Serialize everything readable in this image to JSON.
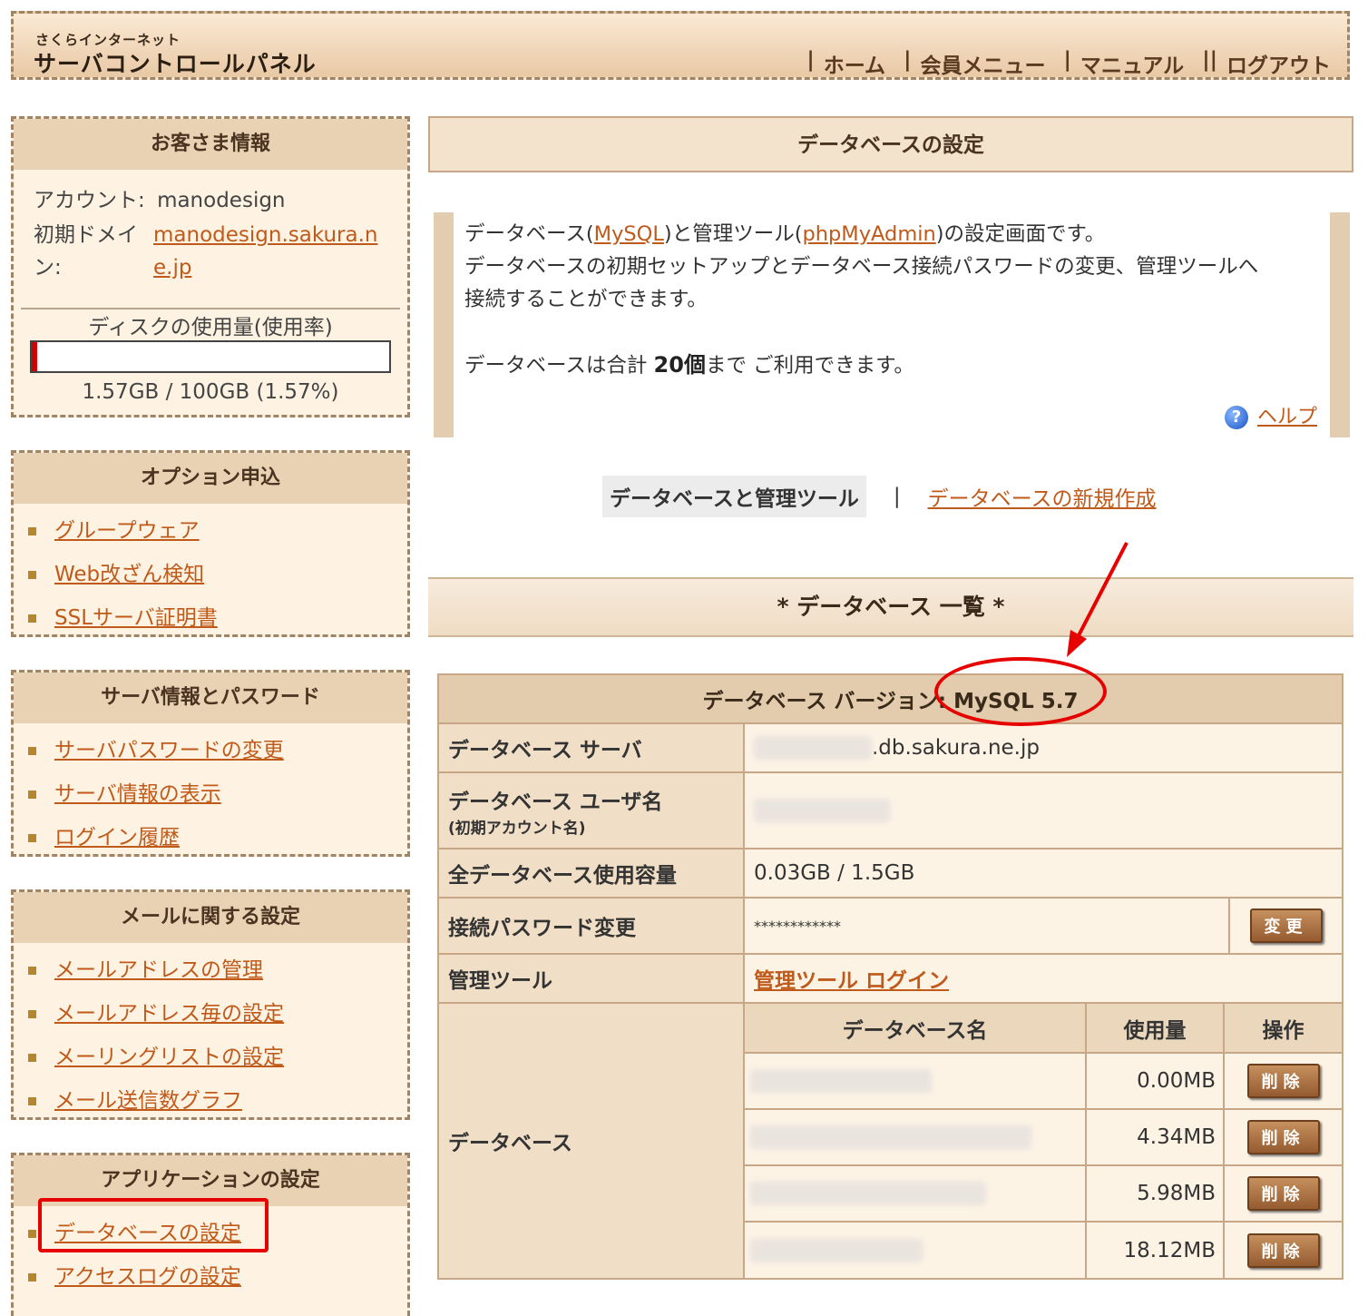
{
  "header": {
    "brand_small": "さくらインターネット",
    "brand_big": "サーバコントロールパネル",
    "nav": [
      {
        "sep": "|",
        "label": "ホーム"
      },
      {
        "sep": "|",
        "label": "会員メニュー"
      },
      {
        "sep": "|",
        "label": "マニュアル"
      },
      {
        "sep": "||",
        "label": "ログアウト"
      }
    ]
  },
  "customer": {
    "title": "お客さま情報",
    "account_label": "アカウント:",
    "account_value": "manodesign",
    "domain_label_1": "初期ドメイ",
    "domain_label_2": "ン:",
    "domain_value_1": "manodesign.sakura.n",
    "domain_value_2": "e.jp",
    "disk_label": "ディスクの使用量(使用率)",
    "disk_usage": "1.57GB / 100GB (1.57%)",
    "disk_percent": 1.57
  },
  "options": {
    "title": "オプション申込",
    "items": [
      "グループウェア",
      "Web改ざん検知",
      "SSLサーバ証明書"
    ]
  },
  "server": {
    "title": "サーバ情報とパスワード",
    "items": [
      "サーバパスワードの変更",
      "サーバ情報の表示",
      "ログイン履歴"
    ]
  },
  "mail": {
    "title": "メールに関する設定",
    "items": [
      "メールアドレスの管理",
      "メールアドレス毎の設定",
      "メーリングリストの設定",
      "メール送信数グラフ"
    ]
  },
  "apps": {
    "title": "アプリケーションの設定",
    "items": [
      "データベースの設定",
      "アクセスログの設定"
    ]
  },
  "main": {
    "title": "データベースの設定",
    "desc_pre": "データベース(",
    "desc_mysql": "MySQL",
    "desc_mid": ")と管理ツール(",
    "desc_pma": "phpMyAdmin",
    "desc_post": ")の設定画面です。",
    "desc_line2": "データベースの初期セットアップとデータベース接続パスワードの変更、管理ツールへ",
    "desc_line3": "接続することができます。",
    "desc_limit_pre": "データベースは合計",
    "desc_limit_num": "20個",
    "desc_limit_post": "まで ご利用できます。",
    "help": "ヘルプ",
    "tab_active": "データベースと管理ツール",
    "tab_sep": "|",
    "tab_new": "データベースの新規作成",
    "list_title": "* データベース 一覧 *"
  },
  "db": {
    "version": "データベース バージョン: MySQL 5.7",
    "server_label": "データベース サーバ",
    "server_suffix": ".db.sakura.ne.jp",
    "user_label": "データベース ユーザ名",
    "user_sub": "(初期アカウント名)",
    "total_label": "全データベース使用容量",
    "total_value": "0.03GB / 1.5GB",
    "pw_label": "接続パスワード変更",
    "pw_value": "************",
    "change_btn": "変更",
    "tool_label": "管理ツール",
    "tool_link": "管理ツール ログイン",
    "db_label": "データベース",
    "col_name": "データベース名",
    "col_usage": "使用量",
    "col_op": "操作",
    "delete_btn": "削除",
    "rows": [
      {
        "usage": "0.00MB"
      },
      {
        "usage": "4.34MB"
      },
      {
        "usage": "5.98MB"
      },
      {
        "usage": "18.12MB"
      }
    ]
  },
  "annotation_color": "#e60000"
}
